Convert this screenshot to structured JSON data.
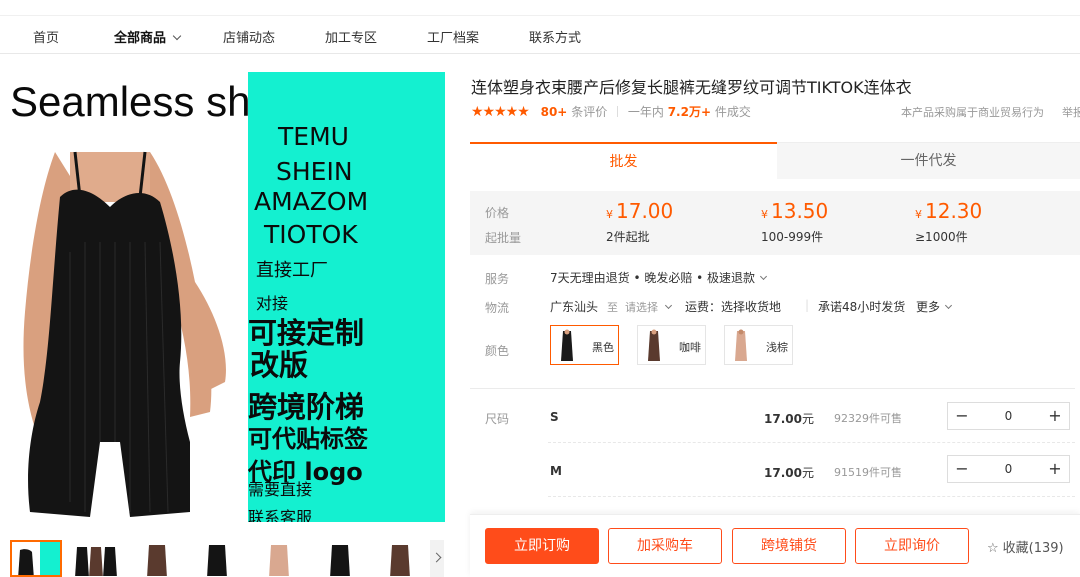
{
  "nav": {
    "items": [
      "首页",
      "全部商品",
      "店铺动态",
      "加工专区",
      "工厂档案",
      "联系方式"
    ]
  },
  "hero": {
    "headline": "Seamless sh",
    "panel_lines": [
      "TEMU",
      "SHEIN",
      "AMAZOM",
      "TIOTOK",
      "直接工厂",
      "对接",
      "可接定制",
      "改版",
      "跨境阶梯",
      "可代贴标签",
      "代印 logo",
      "需要直接",
      "联系客服"
    ]
  },
  "product": {
    "title": "连体塑身衣束腰产后修复长腿裤无缝罗纹可调节TIKTOK连体衣",
    "stars": "★★★★★",
    "review_count": "80+",
    "review_label": "条评价",
    "year_prefix": "一年内",
    "year_sold": "7.2万+",
    "sold_suffix": "件成交",
    "trade_note": "本产品采购属于商业贸易行为",
    "report": "举报"
  },
  "tabs": {
    "wholesale": "批发",
    "dropship": "一件代发"
  },
  "pricing": {
    "price_label": "价格",
    "moq_label": "起批量",
    "currency": "¥",
    "tiers": [
      {
        "price": "17.00",
        "moq": "2件起批"
      },
      {
        "price": "13.50",
        "moq": "100-999件"
      },
      {
        "price": "12.30",
        "moq": "≥1000件"
      }
    ]
  },
  "service": {
    "label": "服务",
    "value": "7天无理由退货 • 晚发必赔 • 极速退款"
  },
  "logistics": {
    "label": "物流",
    "origin": "广东汕头",
    "to": "至",
    "select_placeholder": "请选择",
    "shipping_label": "运费：选择收货地",
    "promise": "承诺48小时发货",
    "more": "更多"
  },
  "colors": {
    "label": "颜色",
    "options": [
      {
        "name": "黑色",
        "swatch": "#1a1a1a",
        "selected": true
      },
      {
        "name": "咖啡",
        "swatch": "#5a3a2e",
        "selected": false
      },
      {
        "name": "浅棕",
        "swatch": "#d9a890",
        "selected": false
      }
    ]
  },
  "sizes": {
    "label": "尺码",
    "rows": [
      {
        "name": "S",
        "price": "17.00",
        "unit": "元",
        "stock": "92329件可售",
        "qty": "0"
      },
      {
        "name": "M",
        "price": "17.00",
        "unit": "元",
        "stock": "91519件可售",
        "qty": "0"
      }
    ],
    "minus": "−",
    "plus": "+"
  },
  "actions": {
    "buy_now": "立即订购",
    "add_cart": "加采购车",
    "cross_border": "跨境铺货",
    "inquiry": "立即询价",
    "favorite": "收藏(139)"
  },
  "theme": {
    "accent": "#ff5a00",
    "teal": "#14f0d0"
  }
}
